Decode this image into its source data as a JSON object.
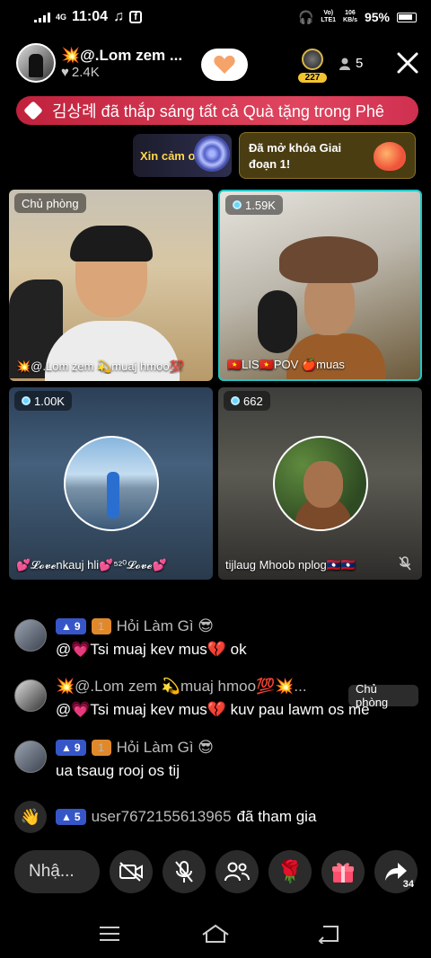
{
  "status_bar": {
    "time": "11:04",
    "network_type": "4G",
    "volte_line1": "Vo)",
    "volte_line2": "LTE1",
    "speed_value": "106",
    "speed_unit": "KB/s",
    "battery": "95%"
  },
  "header": {
    "host_name": "💥@.Lom zem ...",
    "host_likes": "2.4K",
    "rank_number": "227",
    "viewer_count": "5"
  },
  "banner": {
    "text": "김상례 đã thắp sáng tất cả Quà tặng trong Phê"
  },
  "promos": {
    "thanks_label": "Xin cảm ơn",
    "unlock_label": "Đã mở khóa Giai đoạn 1!"
  },
  "guests": [
    {
      "tag": "Chủ phòng",
      "caption": "💥@.Lom zem 💫muaj hmoo💯"
    },
    {
      "tag": "1.59K",
      "caption": "🇻🇳LIS🇻🇳POV 🍎muas"
    },
    {
      "tag": "1.00K",
      "caption": "💕𝓛𝓸𝓿𝓮nkauj hli💕⁵²⁰𝓛𝓸𝓿𝓮💕"
    },
    {
      "tag": "662",
      "caption": "tijlaug Mhoob nplog🇱🇦🇱🇦"
    }
  ],
  "comments": [
    {
      "level": "9",
      "fan_level": "1",
      "username": "Hỏi Làm Gì 😎",
      "text": "@💗Tsi muaj kev mus💔 ok"
    },
    {
      "username": "💥@.Lom zem 💫muaj hmoo💯💥...",
      "host_tag": "Chủ phòng",
      "text": "@💗Tsi muaj kev mus💔 kuv pau lawm os me"
    },
    {
      "level": "9",
      "fan_level": "1",
      "username": "Hỏi Làm Gì 😎",
      "text": "ua tsaug rooj os tij"
    },
    {
      "level": "5",
      "username": "user7672155613965",
      "joined_text": "đã tham gia"
    }
  ],
  "bottom_bar": {
    "compose_placeholder": "Nhậ...",
    "share_count": "34"
  },
  "colors": {
    "banner": "#d0304c",
    "active_tile_border": "#21c6c6",
    "level_badge": "#3656c8",
    "rank_badge": "#f4c430"
  }
}
